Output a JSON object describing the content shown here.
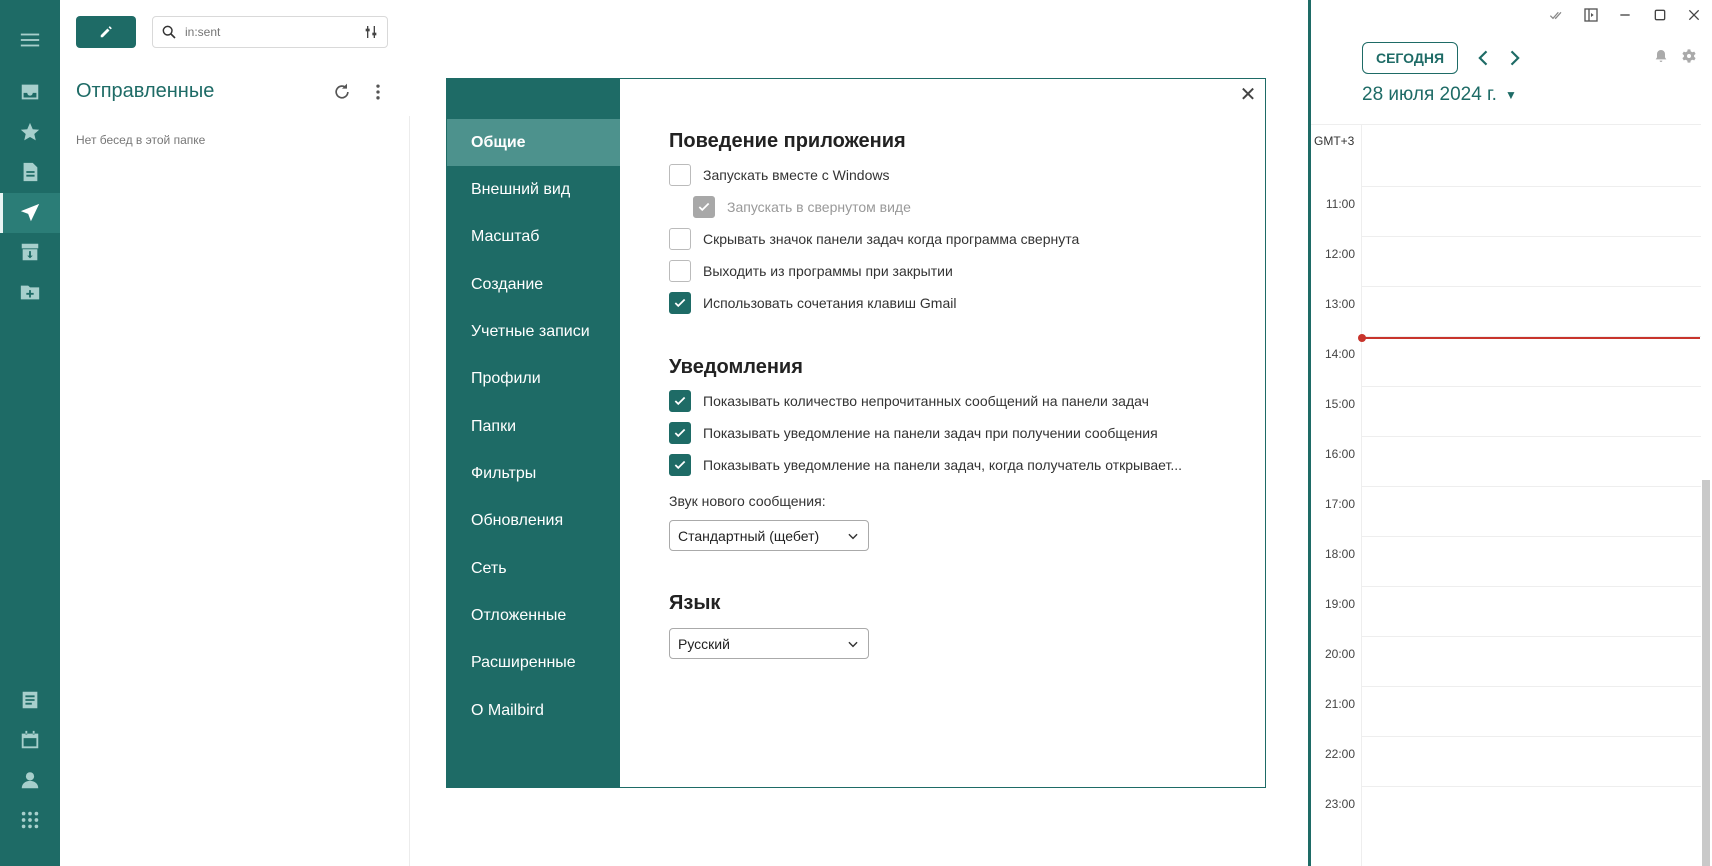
{
  "toolbar": {
    "search_placeholder": "in:sent"
  },
  "mail": {
    "folder_title": "Отправленные",
    "empty_text": "Нет бесед в этой папке"
  },
  "rail": {
    "top_icons": [
      "menu-icon",
      "inbox-icon",
      "star-icon",
      "drafts-icon",
      "send-icon",
      "archive-icon",
      "add-folder-icon"
    ],
    "bottom_icons": [
      "notes-icon",
      "calendar-icon",
      "contacts-icon",
      "apps-grid-icon"
    ],
    "active": "send-icon"
  },
  "settings": {
    "nav": [
      {
        "label": "Общие",
        "active": true
      },
      {
        "label": "Внешний вид"
      },
      {
        "label": "Масштаб"
      },
      {
        "label": "Создание"
      },
      {
        "label": "Учетные записи"
      },
      {
        "label": "Профили"
      },
      {
        "label": "Папки"
      },
      {
        "label": "Фильтры"
      },
      {
        "label": "Обновления"
      },
      {
        "label": "Сеть"
      },
      {
        "label": "Отложенные"
      },
      {
        "label": "Расширенные"
      },
      {
        "label": "О Mailbird"
      }
    ],
    "behavior": {
      "title": "Поведение приложения",
      "options": [
        {
          "label": "Запускать вместе с Windows",
          "checked": false
        },
        {
          "label": "Запускать в свернутом виде",
          "checked": true,
          "disabled": true
        },
        {
          "label": "Скрывать значок панели задач когда программа свернута",
          "checked": false
        },
        {
          "label": "Выходить из программы при закрытии",
          "checked": false
        },
        {
          "label": "Использовать сочетания клавиш Gmail",
          "checked": true
        }
      ]
    },
    "notifications": {
      "title": "Уведомления",
      "options": [
        {
          "label": "Показывать количество непрочитанных сообщений на панели задач",
          "checked": true
        },
        {
          "label": "Показывать уведомление на панели задач при получении сообщения",
          "checked": true
        },
        {
          "label": "Показывать уведомление на панели задач, когда получатель открывает...",
          "checked": true
        }
      ],
      "sound_label": "Звук нового сообщения:",
      "sound_value": "Стандартный (щебет)"
    },
    "language": {
      "title": "Язык",
      "value": "Русский"
    }
  },
  "calendar": {
    "today_label": "СЕГОДНЯ",
    "date_label": "28 июля 2024 г.",
    "timezone": "GMT+3",
    "hours": [
      "11:00",
      "12:00",
      "13:00",
      "14:00",
      "15:00",
      "16:00",
      "17:00",
      "18:00",
      "19:00",
      "20:00",
      "21:00",
      "22:00",
      "23:00"
    ],
    "now_line_color": "#c8342c"
  },
  "colors": {
    "brand": "#1e6b66",
    "nav_active": "#4d928d"
  }
}
